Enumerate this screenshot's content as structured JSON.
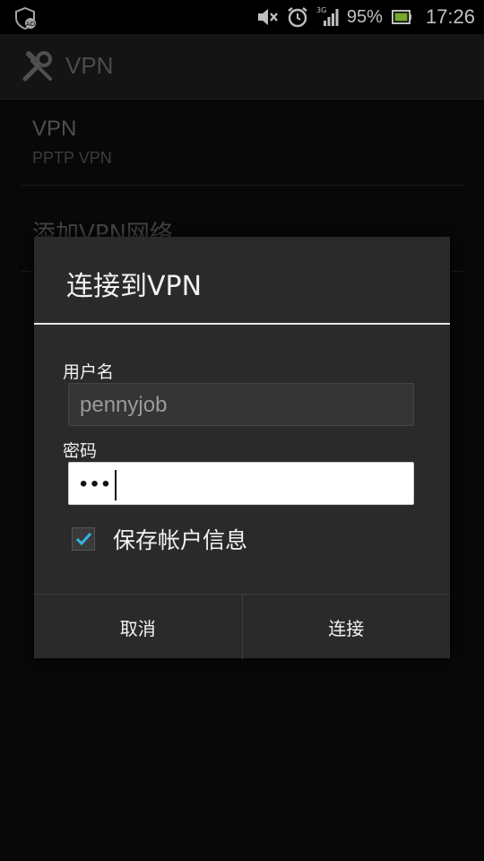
{
  "status_bar": {
    "battery_percent": "95%",
    "time": "17:26",
    "network": "3G",
    "icons": [
      "vpn-shield-icon",
      "mute-icon",
      "alarm-icon",
      "signal-icon",
      "battery-icon"
    ]
  },
  "action_bar": {
    "title": "VPN",
    "icon": "wrench-screwdriver-icon"
  },
  "list": {
    "items": [
      {
        "title": "VPN",
        "subtitle": "PPTP VPN"
      },
      {
        "title": "添加VPN网络"
      }
    ]
  },
  "dialog": {
    "title": "连接到VPN",
    "username_label": "用户名",
    "username_value": "pennyjob",
    "password_label": "密码",
    "password_value": "•••",
    "save_label": "保存帐户信息",
    "save_checked": true,
    "cancel_label": "取消",
    "connect_label": "连接"
  },
  "colors": {
    "accent_check": "#33b5e5",
    "dialog_bg": "#2a2a2a"
  }
}
